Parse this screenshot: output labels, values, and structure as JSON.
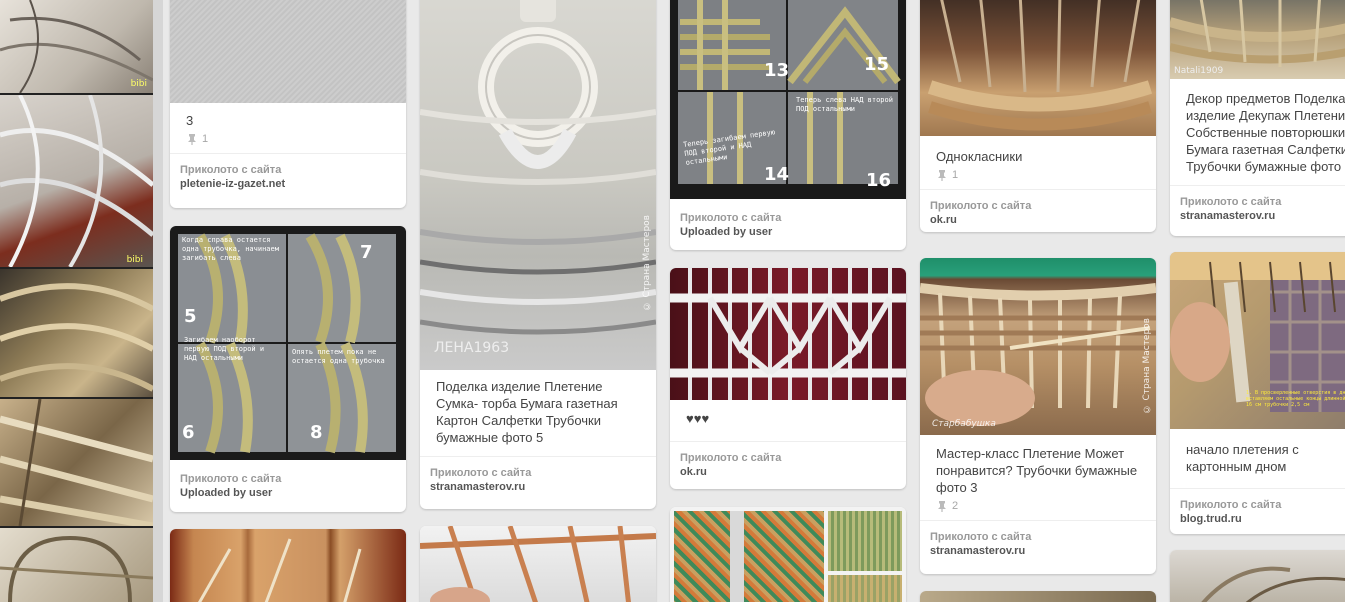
{
  "left_strip": {
    "watermarks": [
      "bibi",
      "bibi"
    ]
  },
  "pins": [
    {
      "id": "col1_pin1",
      "desc": "3",
      "repins": "1",
      "attrib_label": "Приколото с сайта",
      "source": "pletenie-iz-gazet.net"
    },
    {
      "id": "col1_pin2",
      "desc": "",
      "repins": "",
      "attrib_label": "Приколото с сайта",
      "source": "Uploaded by user",
      "image_notes": [
        "Когда справа остается одна трубочка, начинаем загибать слева",
        "Загибаем наоборот первую ПОД второй и НАД остальными",
        "Опять плетем пока не остается одна трубочка"
      ],
      "image_numbers": [
        "5",
        "6",
        "7",
        "8"
      ]
    },
    {
      "id": "col2_pin1",
      "desc": "Поделка изделие Плетение Сумка- торба Бумага газетная Картон Салфетки Трубочки бумажные фото 5",
      "repins": "",
      "attrib_label": "Приколото с сайта",
      "source": "stranamasterov.ru",
      "image_watermark": "ЛЕНА1963",
      "image_watermark2": "© Страна Мастеров"
    },
    {
      "id": "col3_pin1",
      "desc": "",
      "repins": "",
      "attrib_label": "Приколото с сайта",
      "source": "Uploaded by user",
      "image_notes": [
        "Теперь загибаем первую ПОД второй и НАД остальными",
        "Теперь слева НАД второй ПОД остальными"
      ],
      "image_numbers": [
        "13",
        "14",
        "15",
        "16"
      ]
    },
    {
      "id": "col3_pin2",
      "desc": "♥♥♥",
      "repins": "",
      "attrib_label": "Приколото с сайта",
      "source": "ok.ru"
    },
    {
      "id": "col4_pin1",
      "desc": "Однокласники",
      "repins": "1",
      "attrib_label": "Приколото с сайта",
      "source": "ok.ru"
    },
    {
      "id": "col4_pin2",
      "desc": "Мастер-класс Плетение Может понравится? Трубочки бумажные фото 3",
      "repins": "2",
      "attrib_label": "Приколото с сайта",
      "source": "stranamasterov.ru",
      "image_watermark": "Старбабушка",
      "image_watermark2": "© Страна Мастеров"
    },
    {
      "id": "col5_pin1",
      "desc": "Декор предметов Поделка изделие Декупаж Плетение Собственные повторюшки Бумага газетная Салфетки Трубочки бумажные фото",
      "repins": "",
      "attrib_label": "Приколото с сайта",
      "source": "stranamasterov.ru",
      "image_watermark": "Natali1909"
    },
    {
      "id": "col5_pin2",
      "desc": "начало плетения с картонным дном",
      "repins": "",
      "attrib_label": "Приколото с сайта",
      "source": "blog.trud.ru",
      "image_note": "1. В просверленные отверстия в дне вставляем остальные концы длинной 15 - 16 см трубочки 2,5 см"
    }
  ],
  "colors": {
    "background": "#e9e9e9",
    "card": "#ffffff",
    "muted": "#999999",
    "source_text": "#555555"
  }
}
